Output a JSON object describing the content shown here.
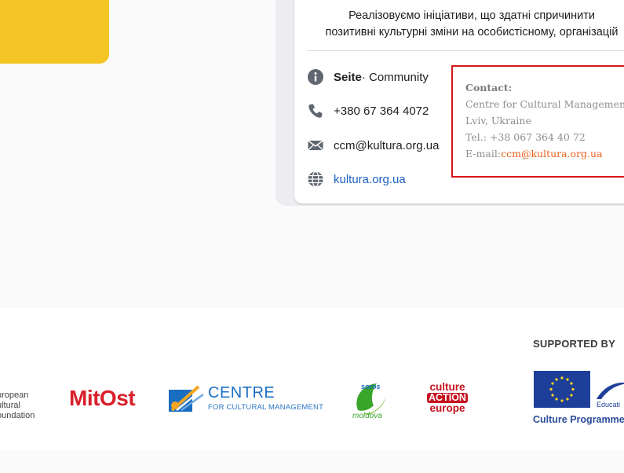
{
  "intro": {
    "line1": "Реалізовуємо ініціативи, що здатні спричинити",
    "line2": "позитивні культурні зміни на особистісному, організацій"
  },
  "info": {
    "page_type_bold": "Seite",
    "page_type_rest": " · Community",
    "phone": "+380 67 364 4072",
    "email": "ccm@kultura.org.ua",
    "website": "kultura.org.ua"
  },
  "contact": {
    "heading": "Contact:",
    "org": "Centre for Cultural Management",
    "city": "Lviv, Ukraine",
    "tel": "Tel.: +38 067 364 40 72",
    "email_label": "E-mail:",
    "email": "ccm@kultura.org.ua"
  },
  "footer": {
    "ecf_line1": "uropean",
    "ecf_line2": "ultural",
    "ecf_line3": "oundation",
    "mitost": "MitOst",
    "ccm_big": "CENTRE",
    "ccm_small": "FOR CULTURAL MANAGEMENT",
    "soros_top": "soros",
    "soros_bottom": "moldova",
    "cae_line1": "culture",
    "cae_line2": "ACTION",
    "cae_line3": "europe",
    "supported_by": "SUPPORTED BY",
    "edu_text": "Educati",
    "culture_programme": "Culture Programme"
  },
  "colors": {
    "accent_yellow": "#f5c526",
    "link_blue": "#1d62c2",
    "contact_border": "#d6161b",
    "email_orange": "#e8601c"
  }
}
